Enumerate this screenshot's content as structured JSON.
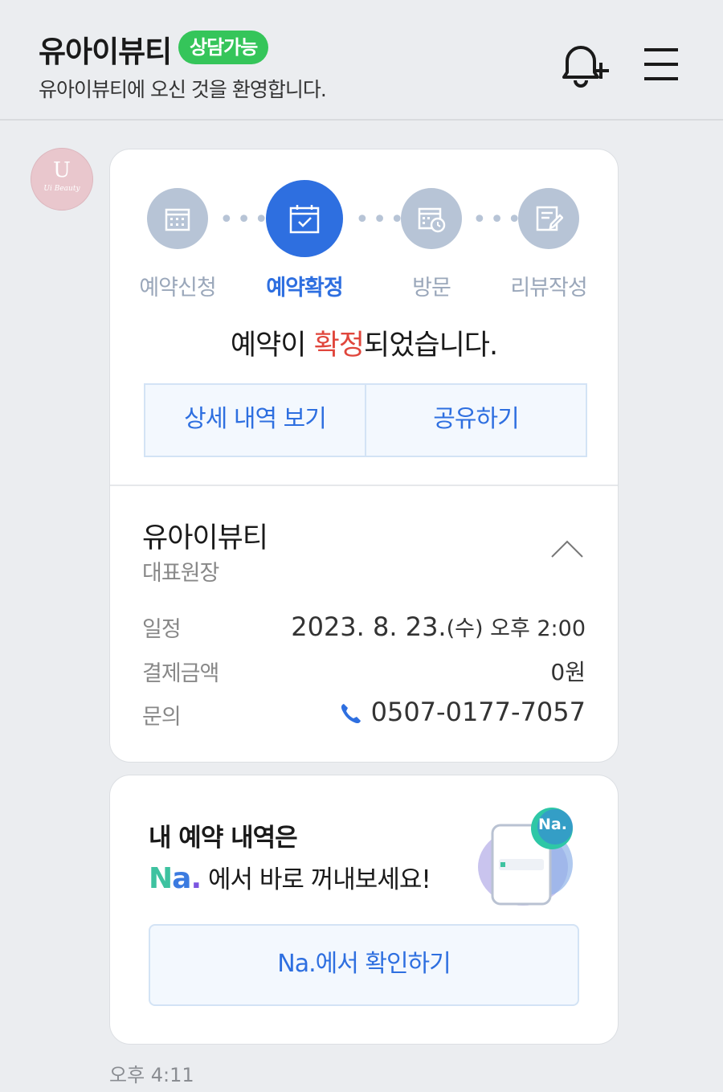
{
  "header": {
    "title": "유아이뷰티",
    "badge": "상담가능",
    "subtitle": "유아이뷰티에 오신 것을 환영합니다."
  },
  "avatar": {
    "logo_text": "U",
    "logo_sub": "Ui Beauty"
  },
  "steps": [
    {
      "label": "예약신청",
      "icon": "calendar-grid-icon",
      "active": false
    },
    {
      "label": "예약확정",
      "icon": "calendar-check-icon",
      "active": true
    },
    {
      "label": "방문",
      "icon": "calendar-clock-icon",
      "active": false
    },
    {
      "label": "리뷰작성",
      "icon": "review-edit-icon",
      "active": false
    }
  ],
  "status": {
    "before": "예약이 ",
    "highlight": "확정",
    "after": "되었습니다."
  },
  "buttons": {
    "details": "상세 내역 보기",
    "share": "공유하기"
  },
  "shop": {
    "name": "유아이뷰티",
    "role": "대표원장",
    "schedule_label": "일정",
    "schedule_date": "2023. 8. 23.",
    "schedule_day": "(수)",
    "schedule_time": " 오후 2:00",
    "payment_label": "결제금액",
    "payment_value": "0원",
    "contact_label": "문의",
    "contact_value": "0507-0177-7057"
  },
  "promo": {
    "line1": "내 예약 내역은",
    "logo_n": "N",
    "logo_a": "a",
    "logo_dot": ".",
    "line2": " 에서 바로 꺼내보세요!",
    "art_badge": "Na.",
    "button": "Na.에서 확인하기"
  },
  "timestamp": "오후 4:11",
  "colors": {
    "accent": "#2e6fe0",
    "badge_green": "#35c55a",
    "highlight_red": "#e0463c",
    "inactive_step": "#b7c4d6"
  }
}
